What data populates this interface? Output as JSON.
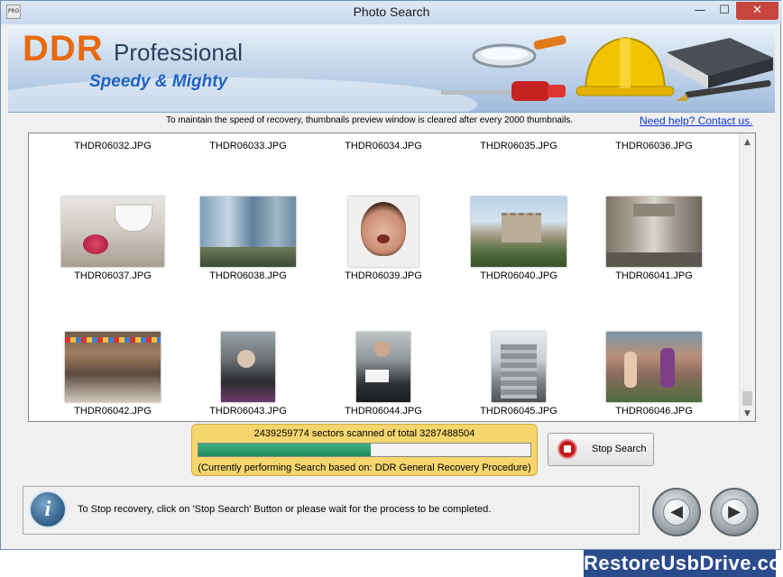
{
  "window": {
    "title": "Photo Search",
    "app_icon_text": "PRO",
    "minimize": "—",
    "maximize": "☐",
    "close": "✕"
  },
  "banner": {
    "brand": "DDR",
    "product": "Professional",
    "tagline": "Speedy & Mighty"
  },
  "notice": "To maintain the speed of recovery, thumbnails preview window is cleared after every 2000 thumbnails.",
  "help_link": "Need help? Contact us.",
  "gallery": {
    "rows": [
      [
        "THDR06032.JPG",
        "THDR06033.JPG",
        "THDR06034.JPG",
        "THDR06035.JPG",
        "THDR06036.JPG"
      ],
      [
        "THDR06037.JPG",
        "THDR06038.JPG",
        "THDR06039.JPG",
        "THDR06040.JPG",
        "THDR06041.JPG"
      ],
      [
        "THDR06042.JPG",
        "THDR06043.JPG",
        "THDR06044.JPG",
        "THDR06045.JPG",
        "THDR06046.JPG"
      ]
    ],
    "scroll_up": "▲",
    "scroll_down": "▼"
  },
  "progress": {
    "sectors_text": "2439259774 sectors scanned of total 3287488504",
    "fraction": 0.52,
    "procedure_text": "(Currently performing Search based on:  DDR General Recovery Procedure)"
  },
  "stop_button": "Stop Search",
  "status": {
    "text": "To Stop recovery, click on 'Stop Search' Button or please wait for the process to be completed.",
    "info_glyph": "i"
  },
  "nav": {
    "back": "◀",
    "next": "▶"
  },
  "watermark": "RestoreUsbDrive.com",
  "colors": {
    "brand_orange": "#e86a10",
    "tagline_blue": "#1f63c4",
    "progress_panel": "#f5d66e",
    "progress_fill": "#1e8a5a",
    "link_blue": "#0b36d4",
    "close_red": "#c7463c"
  }
}
